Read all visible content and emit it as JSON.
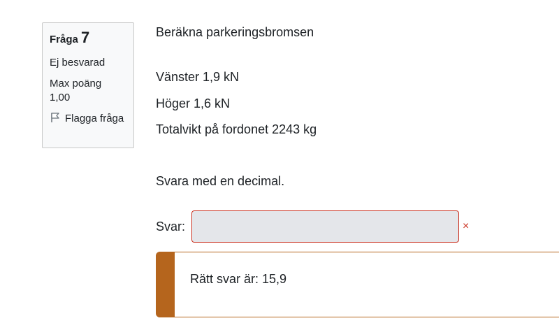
{
  "question_info": {
    "label": "Fråga",
    "number": "7",
    "status": "Ej besvarad",
    "max_points_label": "Max poäng",
    "max_points_value": "1,00",
    "flag_label": "Flagga fråga"
  },
  "question": {
    "title": "Beräkna parkeringsbromsen",
    "left_force": "Vänster 1,9 kN",
    "right_force": "Höger 1,6 kN",
    "total_weight": "Totalvikt på fordonet 2243 kg",
    "instruction": "Svara med en decimal."
  },
  "answer": {
    "label": "Svar:",
    "value": "",
    "result_icon": "×"
  },
  "feedback": {
    "correct_answer": "Rätt svar är: 15,9"
  },
  "colors": {
    "error": "#ca3120",
    "accent": "#b5651d",
    "input_bg": "#e4e6ea"
  }
}
